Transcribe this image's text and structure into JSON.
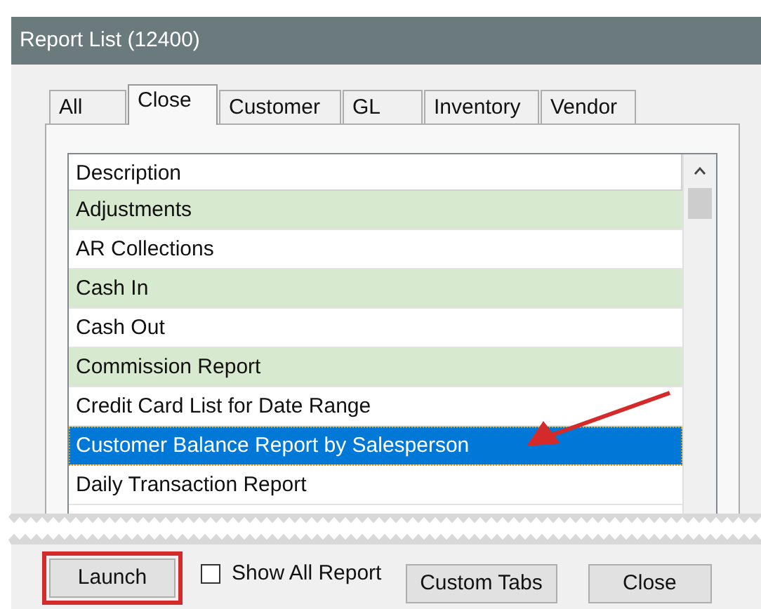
{
  "window": {
    "title": "Report List (12400)"
  },
  "tabs": [
    {
      "label": "All",
      "selected": false
    },
    {
      "label": "Close",
      "selected": true
    },
    {
      "label": "Customer",
      "selected": false
    },
    {
      "label": "GL",
      "selected": false
    },
    {
      "label": "Inventory",
      "selected": false
    },
    {
      "label": "Vendor",
      "selected": false
    }
  ],
  "list": {
    "header": "Description",
    "rows": [
      {
        "label": "Adjustments",
        "shaded": true,
        "selected": false
      },
      {
        "label": "AR Collections",
        "shaded": false,
        "selected": false
      },
      {
        "label": "Cash In",
        "shaded": true,
        "selected": false
      },
      {
        "label": "Cash Out",
        "shaded": false,
        "selected": false
      },
      {
        "label": "Commission Report",
        "shaded": true,
        "selected": false
      },
      {
        "label": "Credit Card List for Date Range",
        "shaded": false,
        "selected": false
      },
      {
        "label": "Customer Balance Report by Salesperson",
        "shaded": false,
        "selected": true
      },
      {
        "label": "Daily Transaction Report",
        "shaded": false,
        "selected": false
      }
    ]
  },
  "footer": [
    {
      "kind": "button",
      "label": "Launch",
      "highlighted": true
    },
    {
      "kind": "checkbox",
      "label": "Show All Report",
      "checked": false
    },
    {
      "kind": "button",
      "label": "Custom Tabs",
      "highlighted": false
    },
    {
      "kind": "button",
      "label": "Close",
      "highlighted": false
    }
  ]
}
